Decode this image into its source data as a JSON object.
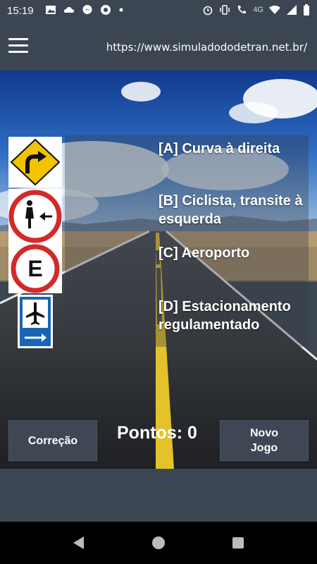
{
  "status_bar": {
    "time": "15:19",
    "left_icons": [
      "image-icon",
      "cloud-icon",
      "messenger-icon",
      "chrome-icon",
      "dot-icon"
    ],
    "network_label": "4G",
    "right_icons": [
      "alarm-icon",
      "vibrate-icon",
      "wifi-call-icon",
      "wifi-icon",
      "signal-icon",
      "battery-icon"
    ]
  },
  "app_bar": {
    "menu_icon": "hamburger-menu-icon",
    "url": "https://www.simuladododetran.net.br/"
  },
  "answers": [
    {
      "key": "A",
      "text": "[A] Curva à direita"
    },
    {
      "key": "B",
      "text": "[B] Ciclista, transite à esquerda"
    },
    {
      "key": "C",
      "text": "[C] Aeroporto"
    },
    {
      "key": "D",
      "text": "[D]  Estacionamento regulamentado"
    }
  ],
  "signs": [
    {
      "name": "right-curve-sign-icon"
    },
    {
      "name": "cyclist-keep-left-sign-icon"
    },
    {
      "name": "parking-regulated-sign-icon",
      "letter": "E"
    },
    {
      "name": "airport-sign-icon"
    }
  ],
  "controls": {
    "correction_label": "Correção",
    "new_game_label": "Novo\nJogo",
    "score_label": "Pontos:",
    "score_value": "0"
  },
  "colors": {
    "bar_bg": "#3c4652",
    "button_bg": "#3e4753",
    "sign_yellow": "#f2c300",
    "sign_red": "#d22a2a",
    "sign_blue": "#1a64b4"
  },
  "nav": {
    "back_icon": "back-triangle-icon",
    "home_icon": "home-circle-icon",
    "recents_icon": "recents-square-icon"
  }
}
